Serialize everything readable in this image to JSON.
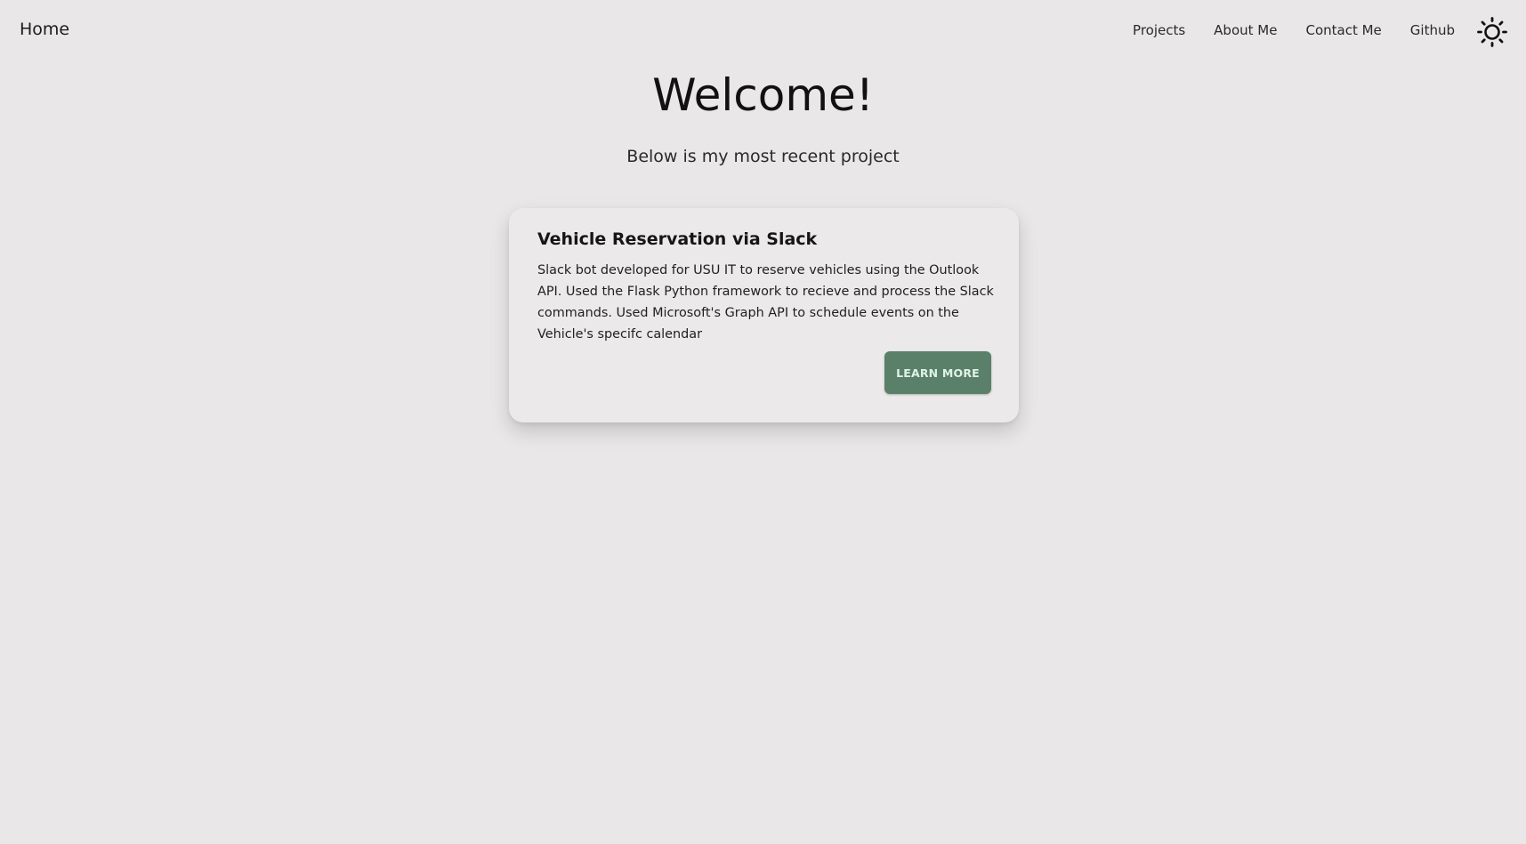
{
  "nav": {
    "brand": "Home",
    "links": [
      "Projects",
      "About Me",
      "Contact Me",
      "Github"
    ],
    "theme_toggle_icon": "sun-icon"
  },
  "hero": {
    "title": "Welcome!",
    "subtitle": "Below is my most recent project"
  },
  "project_card": {
    "title": "Vehicle Reservation via Slack",
    "description": "Slack bot developed for USU IT to reserve vehicles using the Outlook API. Used the Flask Python framework to recieve and process the Slack commands. Used Microsoft's Graph API to schedule events on the Vehicle's specifc calendar",
    "button_label": "LEARN MORE"
  },
  "colors": {
    "background": "#e9e7e8",
    "button": "#5a806a",
    "button_text": "#dff2e4"
  }
}
